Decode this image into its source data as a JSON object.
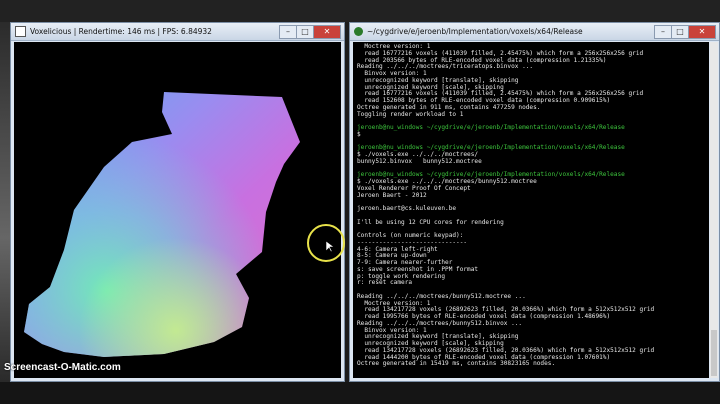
{
  "left_window": {
    "title": "Voxelicious | Rendertime: 146 ms | FPS: 6.84932",
    "controls": {
      "minimize": "–",
      "maximize": "□",
      "close": "✕"
    }
  },
  "right_window": {
    "title": "~/cygdrive/e/jeroenb/Implementation/voxels/x64/Release",
    "controls": {
      "minimize": "–",
      "maximize": "□",
      "close": "✕"
    },
    "lines": [
      {
        "t": "  Moctree version: 1",
        "c": "w"
      },
      {
        "t": "  read 16777216 voxels (411039 filled, 2.45475%) which form a 256x256x256 grid",
        "c": "w"
      },
      {
        "t": "  read 203566 bytes of RLE-encoded voxel data (compression 1.21335%)",
        "c": "w"
      },
      {
        "t": "Reading ../../../moctrees/triceratops.binvox ...",
        "c": "w"
      },
      {
        "t": "  Binvox version: 1",
        "c": "w"
      },
      {
        "t": "  unrecognized keyword [translate], skipping",
        "c": "w"
      },
      {
        "t": "  unrecognized keyword [scale], skipping",
        "c": "w"
      },
      {
        "t": "  read 16777216 voxels (411039 filled, 2.45475%) which form a 256x256x256 grid",
        "c": "w"
      },
      {
        "t": "  read 152608 bytes of RLE-encoded voxel data (compression 0.909615%)",
        "c": "w"
      },
      {
        "t": "Octree generated in 911 ms, contains 477259 nodes.",
        "c": "w"
      },
      {
        "t": "Toggling render workload to 1",
        "c": "w"
      },
      {
        "t": "",
        "c": "w"
      },
      {
        "t": "jeroenb@nu_windows ~/cygdrive/e/jeroenb/Implementation/voxels/x64/Release",
        "c": "g"
      },
      {
        "t": "$",
        "c": "w"
      },
      {
        "t": "",
        "c": "w"
      },
      {
        "t": "jeroenb@nu_windows ~/cygdrive/e/jeroenb/Implementation/voxels/x64/Release",
        "c": "g"
      },
      {
        "t": "$ ./voxels.exe ../../../moctrees/",
        "c": "w"
      },
      {
        "t": "bunny512.binvox   bunny512.moctree",
        "c": "w"
      },
      {
        "t": "",
        "c": "w"
      },
      {
        "t": "jeroenb@nu_windows ~/cygdrive/e/jeroenb/Implementation/voxels/x64/Release",
        "c": "g"
      },
      {
        "t": "$ ./voxels.exe ../../../moctrees/bunny512.moctree",
        "c": "w"
      },
      {
        "t": "Voxel Renderer Proof Of Concept",
        "c": "w"
      },
      {
        "t": "Jeroen Baert - 2012",
        "c": "w"
      },
      {
        "t": "",
        "c": "w"
      },
      {
        "t": "jeroen.baert@cs.kuleuven.be",
        "c": "w"
      },
      {
        "t": "",
        "c": "w"
      },
      {
        "t": "I'll be using 12 CPU cores for rendering",
        "c": "w"
      },
      {
        "t": "",
        "c": "w"
      },
      {
        "t": "Controls (on numeric keypad):",
        "c": "w"
      },
      {
        "t": "------------------------------",
        "c": "w"
      },
      {
        "t": "4-6: Camera left-right",
        "c": "w"
      },
      {
        "t": "8-5: Camera up-down",
        "c": "w"
      },
      {
        "t": "7-9: Camera nearer-further",
        "c": "w"
      },
      {
        "t": "s: save screenshot in .PPM format",
        "c": "w"
      },
      {
        "t": "p: toggle work rendering",
        "c": "w"
      },
      {
        "t": "r: reset camera",
        "c": "w"
      },
      {
        "t": "",
        "c": "w"
      },
      {
        "t": "Reading ../../../moctrees/bunny512.moctree ...",
        "c": "w"
      },
      {
        "t": "  Moctree version: 1",
        "c": "w"
      },
      {
        "t": "  read 134217728 voxels (26892623 filled, 20.0366%) which form a 512x512x512 grid",
        "c": "w"
      },
      {
        "t": "  read 1995766 bytes of RLE-encoded voxel data (compression 1.48696%)",
        "c": "w"
      },
      {
        "t": "Reading ../../../moctrees/bunny512.binvox ...",
        "c": "w"
      },
      {
        "t": "  Binvox version: 1",
        "c": "w"
      },
      {
        "t": "  unrecognized keyword [translate], skipping",
        "c": "w"
      },
      {
        "t": "  unrecognized keyword [scale], skipping",
        "c": "w"
      },
      {
        "t": "  read 134217728 voxels (26892623 filled, 20.0366%) which form a 512x512x512 grid",
        "c": "w"
      },
      {
        "t": "  read 1444200 bytes of RLE-encoded voxel data (compression 1.07601%)",
        "c": "w"
      },
      {
        "t": "Octree generated in 15419 ms, contains 30823165 nodes.",
        "c": "w"
      }
    ]
  },
  "watermark": "Screencast-O-Matic.com",
  "colors": {
    "prompt_green": "#3cc43c",
    "console_bg": "#000000",
    "cursor_ring": "#e8e24a"
  }
}
